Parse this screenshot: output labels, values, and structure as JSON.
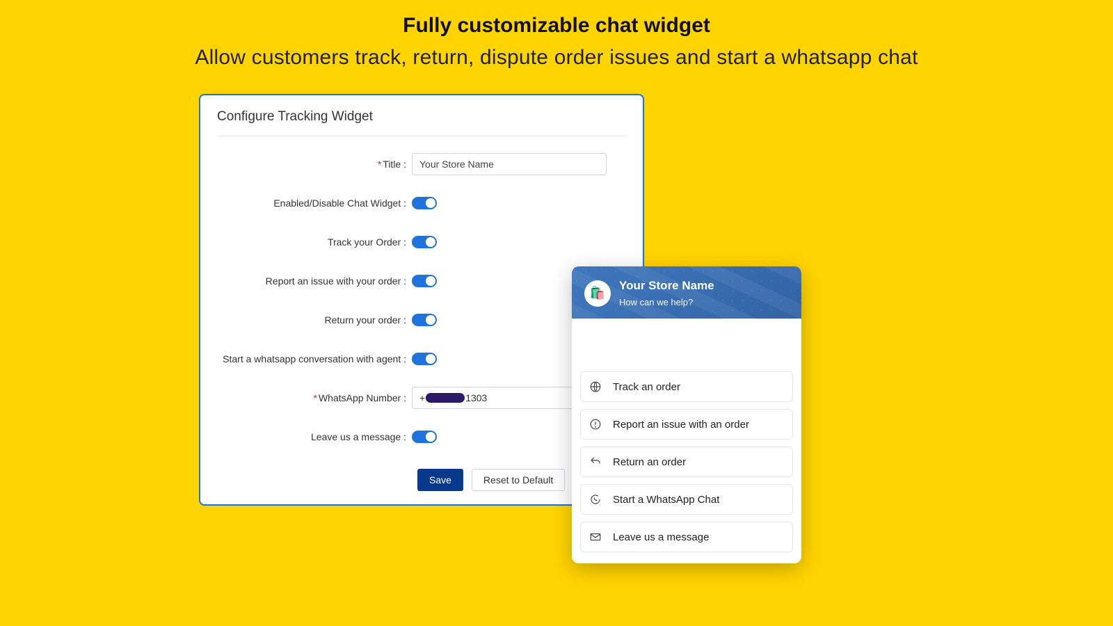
{
  "hero": {
    "title": "Fully customizable chat widget",
    "subtitle": "Allow customers track, return, dispute order issues and start a whatsapp chat"
  },
  "settings": {
    "card_title": "Configure Tracking Widget",
    "labels": {
      "title": "Title :",
      "enable": "Enabled/Disable Chat Widget :",
      "track": "Track your Order :",
      "report": "Report an issue with your order :",
      "return": "Return your order :",
      "whatsapp_conv": "Start a whatsapp conversation with agent :",
      "whatsapp_num": "WhatsApp Number :",
      "leave_msg": "Leave us a message :"
    },
    "title_value": "Your Store Name",
    "wa_prefix": "+",
    "wa_suffix": "1303",
    "buttons": {
      "save": "Save",
      "reset": "Reset to Default"
    }
  },
  "widget": {
    "store": "Your Store Name",
    "prompt": "How can we help?",
    "items": [
      {
        "label": "Track an order"
      },
      {
        "label": "Report an issue with an order"
      },
      {
        "label": "Return an order"
      },
      {
        "label": "Start a WhatsApp Chat"
      },
      {
        "label": "Leave us a message"
      }
    ]
  }
}
